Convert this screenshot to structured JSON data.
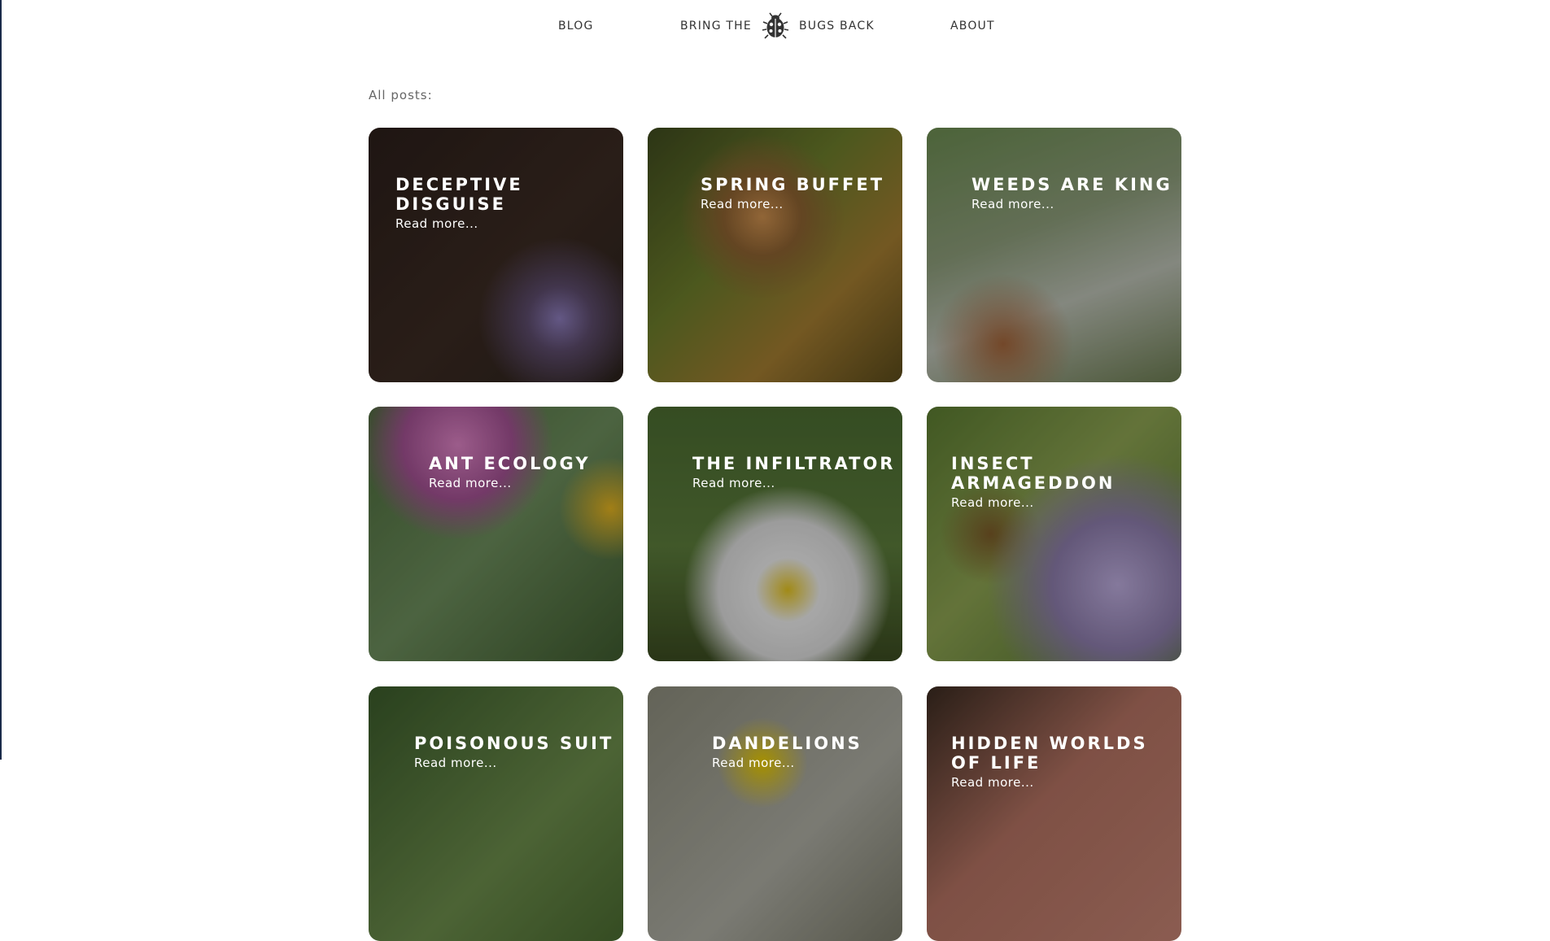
{
  "nav": {
    "blog_label": "BLOG",
    "brand_left": "BRING THE",
    "brand_right": "BUGS BACK",
    "brand_icon": "ladybug-icon",
    "about_label": "ABOUT"
  },
  "section_label": "All posts:",
  "posts": [
    {
      "title": "DECEPTIVE DISGUISE",
      "more": "Read more..."
    },
    {
      "title": "SPRING BUFFET",
      "more": "Read more..."
    },
    {
      "title": "WEEDS ARE KING",
      "more": "Read more..."
    },
    {
      "title": "ANT ECOLOGY",
      "more": "Read more..."
    },
    {
      "title": "THE INFILTRATOR",
      "more": "Read more..."
    },
    {
      "title": "INSECT ARMAGEDDON",
      "more": "Read more..."
    },
    {
      "title": "POISONOUS SUIT",
      "more": "Read more..."
    },
    {
      "title": "DANDELIONS",
      "more": "Read more..."
    },
    {
      "title": "HIDDEN WORLDS OF LIFE",
      "more": "Read more..."
    }
  ]
}
